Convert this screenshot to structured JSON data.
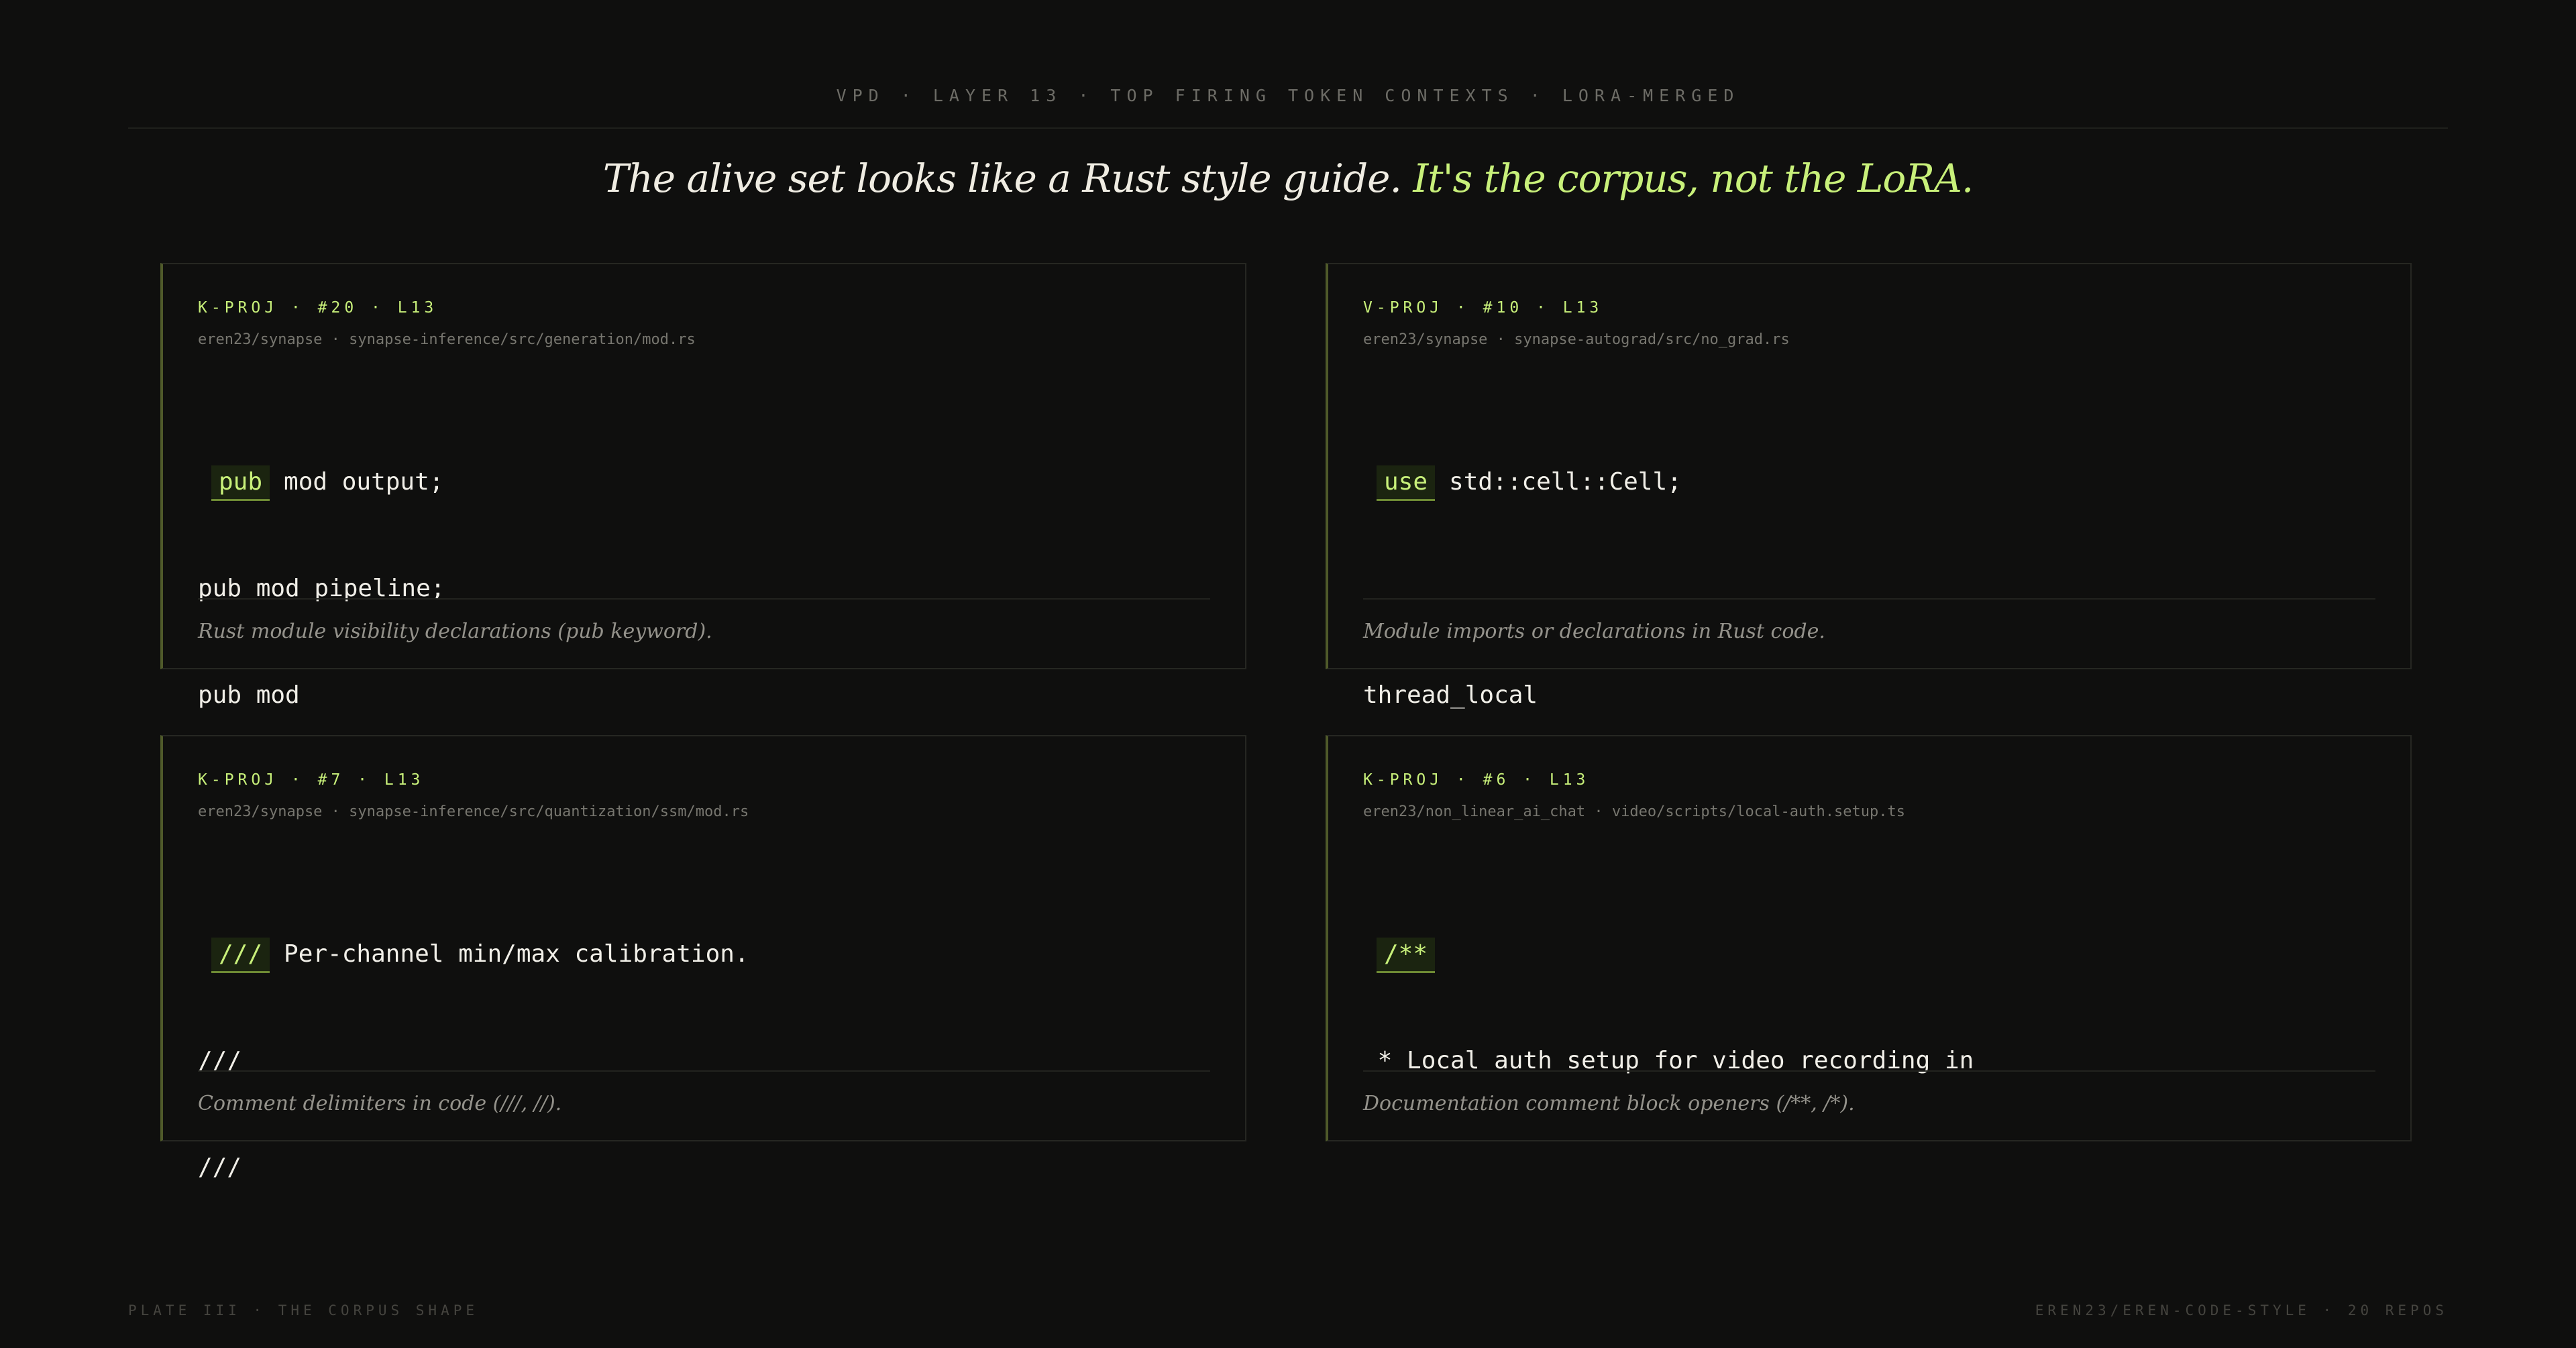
{
  "header": "VPD · LAYER 13 · TOP FIRING TOKEN CONTEXTS · LORA-MERGED",
  "title": {
    "main": "The alive set looks like a Rust style guide.",
    "accent": "It's the corpus, not the LoRA."
  },
  "colors": {
    "background": "#0f0f0e",
    "accent": "#c8f07a",
    "text": "#f1efe8",
    "muted": "#77766f"
  },
  "cards": [
    {
      "tag": "K-PROJ · #20 · L13",
      "source": "eren23/synapse · synapse-inference/src/generation/mod.rs",
      "highlight": "pub",
      "first_line_rest": "mod output;",
      "lines": [
        "pub mod pipeline;",
        "pub mod"
      ],
      "description": "Rust module visibility declarations (pub keyword)."
    },
    {
      "tag": "V-PROJ · #10 · L13",
      "source": "eren23/synapse · synapse-autograd/src/no_grad.rs",
      "highlight": "use",
      "first_line_rest": "std::cell::Cell;",
      "lines": [
        "",
        "thread_local"
      ],
      "description": "Module imports or declarations in Rust code."
    },
    {
      "tag": "K-PROJ · #7 · L13",
      "source": "eren23/synapse · synapse-inference/src/quantization/ssm/mod.rs",
      "highlight": "///",
      "first_line_rest": "Per-channel min/max calibration.",
      "lines": [
        "///",
        "///"
      ],
      "description": "Comment delimiters in code (///, //)."
    },
    {
      "tag": "K-PROJ · #6 · L13",
      "source": "eren23/non_linear_ai_chat · video/scripts/local-auth.setup.ts",
      "highlight": "/**",
      "first_line_rest": "",
      "lines": [
        " * Local auth setup for video recording in"
      ],
      "description": "Documentation comment block openers (/**, /*)."
    }
  ],
  "footer": {
    "left": "PLATE III · THE CORPUS SHAPE",
    "right": "EREN23/EREN-CODE-STYLE · 20 REPOS"
  }
}
